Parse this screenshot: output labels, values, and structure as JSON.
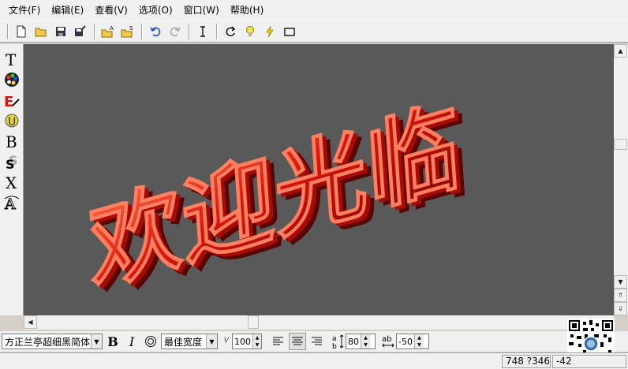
{
  "menu": [
    {
      "label": "文件(F)"
    },
    {
      "label": "编辑(E)"
    },
    {
      "label": "查看(V)"
    },
    {
      "label": "选项(O)"
    },
    {
      "label": "窗口(W)"
    },
    {
      "label": "帮助(H)"
    }
  ],
  "canvas": {
    "text": "欢迎光临",
    "bg_color": "#595959",
    "text_color": "#e0140a"
  },
  "format": {
    "font": "方正兰亭超细黑简体",
    "width_mode": "最佳宽度",
    "char_scale": "100",
    "line_spacing": "80",
    "char_spacing": "-50"
  },
  "status": {
    "coords": "748 ?346",
    "extra": "-42"
  }
}
